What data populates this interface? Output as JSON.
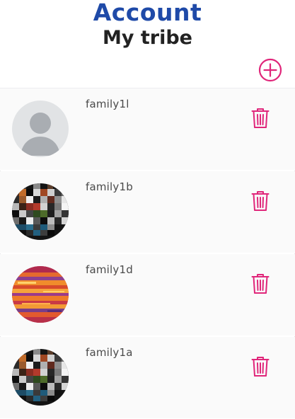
{
  "header": {
    "title": "Account",
    "subtitle": "My tribe"
  },
  "colors": {
    "brand_blue": "#1f4aa8",
    "accent_pink": "#e0267a"
  },
  "icons": {
    "add": "plus-circle-icon",
    "delete": "trash-icon",
    "placeholder_avatar": "user-silhouette-icon"
  },
  "members": [
    {
      "name": "family1l",
      "avatar": "placeholder"
    },
    {
      "name": "family1b",
      "avatar": "mosaic"
    },
    {
      "name": "family1d",
      "avatar": "sunset"
    },
    {
      "name": "family1a",
      "avatar": "mosaic"
    }
  ]
}
